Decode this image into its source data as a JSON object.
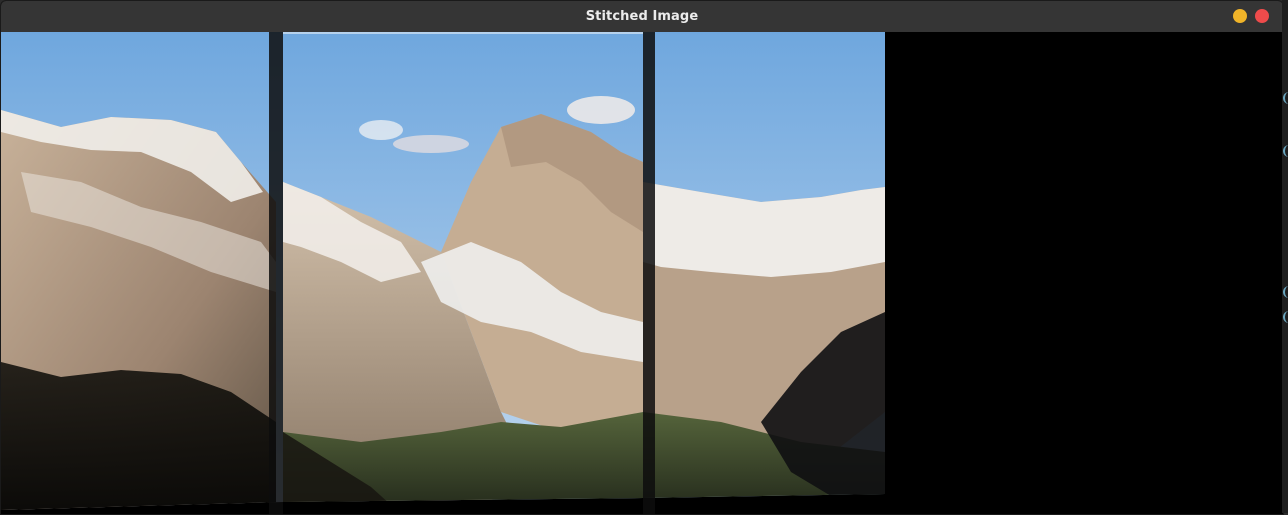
{
  "window": {
    "title": "Stitched Image"
  },
  "controls": {
    "minimize_color": "#f0b429",
    "close_color": "#ee4b4b"
  },
  "image": {
    "description_icon": "stitched-panorama-image",
    "panels": 3
  },
  "colors": {
    "sky_top": "#7aaee0",
    "sky_bottom": "#b9d4ee",
    "snow": "#f2f0ee",
    "rock": "#b49a83",
    "shadow": "#1a1a14",
    "forest": "#3f4a2a",
    "seam": "#0d0d0d"
  }
}
